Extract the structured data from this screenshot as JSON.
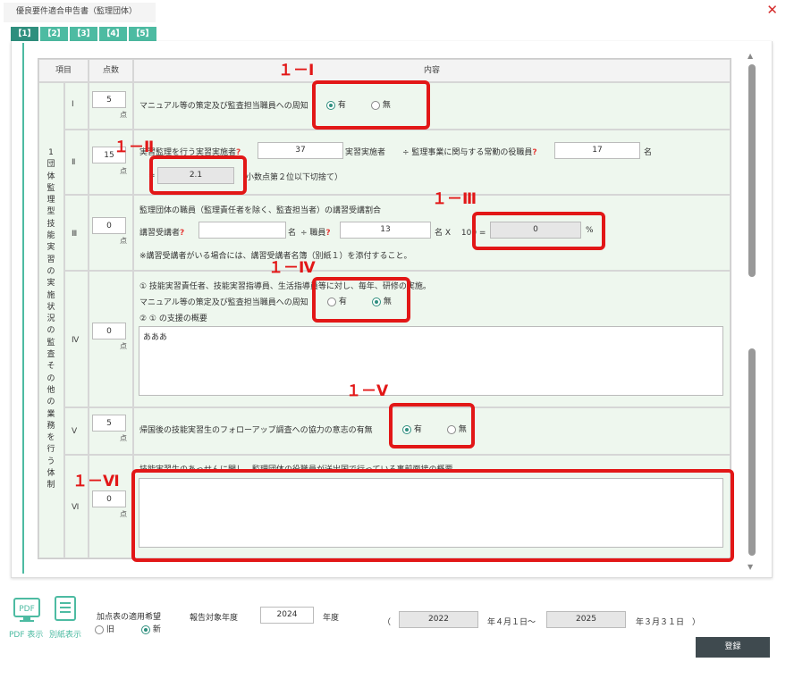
{
  "window": {
    "title": "優良要件適合申告書（監理団体）",
    "close_label": "✕"
  },
  "tabs": [
    "【1】",
    "【2】",
    "【3】",
    "【4】",
    "【5】"
  ],
  "table": {
    "headers": {
      "item": "項目",
      "score": "点数",
      "content": "内容"
    },
    "category_vertical": "1団体監理型技能実習の実施状況の監査その他の業務を行う体制",
    "point_unit": "点",
    "rows": {
      "r1": {
        "roman": "Ⅰ",
        "score": "5",
        "label": "マニュアル等の策定及び監査担当職員への周知",
        "radio_yes": "有",
        "radio_no": "無",
        "selected": "yes"
      },
      "r2": {
        "roman": "Ⅱ",
        "score": "15",
        "label1": "実習監理を行う実習実施者",
        "value1": "37",
        "label2": "実習実施者",
        "label3": "÷ 監理事業に関与する常勤の役職員",
        "value2": "17",
        "unit": "名",
        "prefix": "=",
        "result": "2.1",
        "note": "（小数点第２位以下切捨て）"
      },
      "r3": {
        "roman": "Ⅲ",
        "score": "0",
        "heading": "監理団体の職員（監理責任者を除く、監査担当者）の講習受講割合",
        "label1": "講習受講者",
        "value1": "",
        "unit": "名",
        "label2": "÷ 職員",
        "value2": "13",
        "formula": "名 X 　100 =",
        "result": "0",
        "percent": "%",
        "note": "※講習受講者がいる場合には、講習受講者名簿（別紙１）を添付すること。"
      },
      "r4": {
        "roman": "Ⅳ",
        "score": "0",
        "line1": "① 技能実習責任者、技能実習指導員、生活指導員等に対し、毎年、研修の実施。",
        "line2": "マニュアル等の策定及び監査担当職員への周知",
        "radio_yes": "有",
        "radio_no": "無",
        "selected": "no",
        "line3": "② ① の支援の概要",
        "textarea": "あああ"
      },
      "r5": {
        "roman": "Ⅴ",
        "score": "5",
        "label": "帰国後の技能実習生のフォローアップ調査への協力の意志の有無",
        "radio_yes": "有",
        "radio_no": "無",
        "selected": "yes"
      },
      "r6": {
        "roman": "Ⅵ",
        "score": "0",
        "label": "技能実習生のあっせんに関し、監理団体の役職員が送出国で行っている事前面接の概要",
        "textarea": ""
      }
    }
  },
  "annotations": [
    "１－Ⅰ",
    "１－Ⅱ",
    "１－Ⅲ",
    "１－Ⅳ",
    "１－Ⅴ",
    "１－Ⅵ"
  ],
  "footer": {
    "pdf_icon_text": "PDF",
    "pdf_label": "PDF 表示",
    "sheet_label": "別紙表示",
    "bonus_label": "加点表の適用希望",
    "old_label": "旧",
    "new_label": "新",
    "year_label": "報告対象年度",
    "year_value": "2024",
    "year_unit": "年度",
    "open_paren": "（",
    "from_year": "2022",
    "from_suffix": "年４月１日〜",
    "to_year": "2025",
    "to_suffix": "年３月３１日",
    "close_paren": "）",
    "register": "登録"
  },
  "colors": {
    "accent": "#4dbba2",
    "annotation": "#e21717",
    "row_bg": "#eef7ee"
  }
}
